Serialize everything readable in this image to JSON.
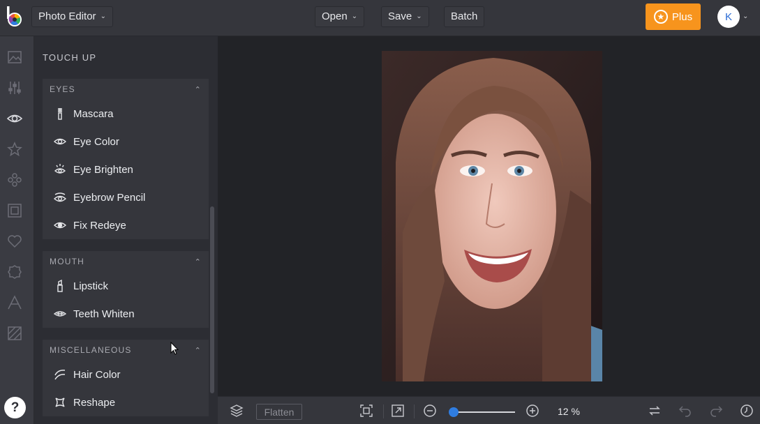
{
  "header": {
    "app_mode": "Photo Editor",
    "open_label": "Open",
    "save_label": "Save",
    "batch_label": "Batch",
    "plus_label": "Plus",
    "avatar_letter": "K"
  },
  "panel": {
    "title": "TOUCH UP",
    "sections": [
      {
        "title": "EYES",
        "items": [
          {
            "label": "Mascara",
            "icon": "mascara-icon"
          },
          {
            "label": "Eye Color",
            "icon": "eye-icon"
          },
          {
            "label": "Eye Brighten",
            "icon": "eye-brighten-icon"
          },
          {
            "label": "Eyebrow Pencil",
            "icon": "eyebrow-icon"
          },
          {
            "label": "Fix Redeye",
            "icon": "redeye-icon"
          }
        ]
      },
      {
        "title": "MOUTH",
        "items": [
          {
            "label": "Lipstick",
            "icon": "lipstick-icon"
          },
          {
            "label": "Teeth Whiten",
            "icon": "teeth-icon"
          }
        ]
      },
      {
        "title": "MISCELLANEOUS",
        "items": [
          {
            "label": "Hair Color",
            "icon": "hair-icon"
          },
          {
            "label": "Reshape",
            "icon": "reshape-icon"
          }
        ]
      }
    ]
  },
  "toolbar": {
    "flatten_label": "Flatten",
    "zoom_value": "12 %",
    "zoom_fraction": 0.02
  },
  "colors": {
    "accent_orange": "#f7941d",
    "accent_blue": "#2f7de1",
    "background": "#2c2d33"
  },
  "rail_icons": [
    "image-icon",
    "adjust-icon",
    "eye-icon",
    "star-icon",
    "effects-icon",
    "frame-icon",
    "heart-icon",
    "badge-icon",
    "text-icon",
    "texture-icon"
  ]
}
